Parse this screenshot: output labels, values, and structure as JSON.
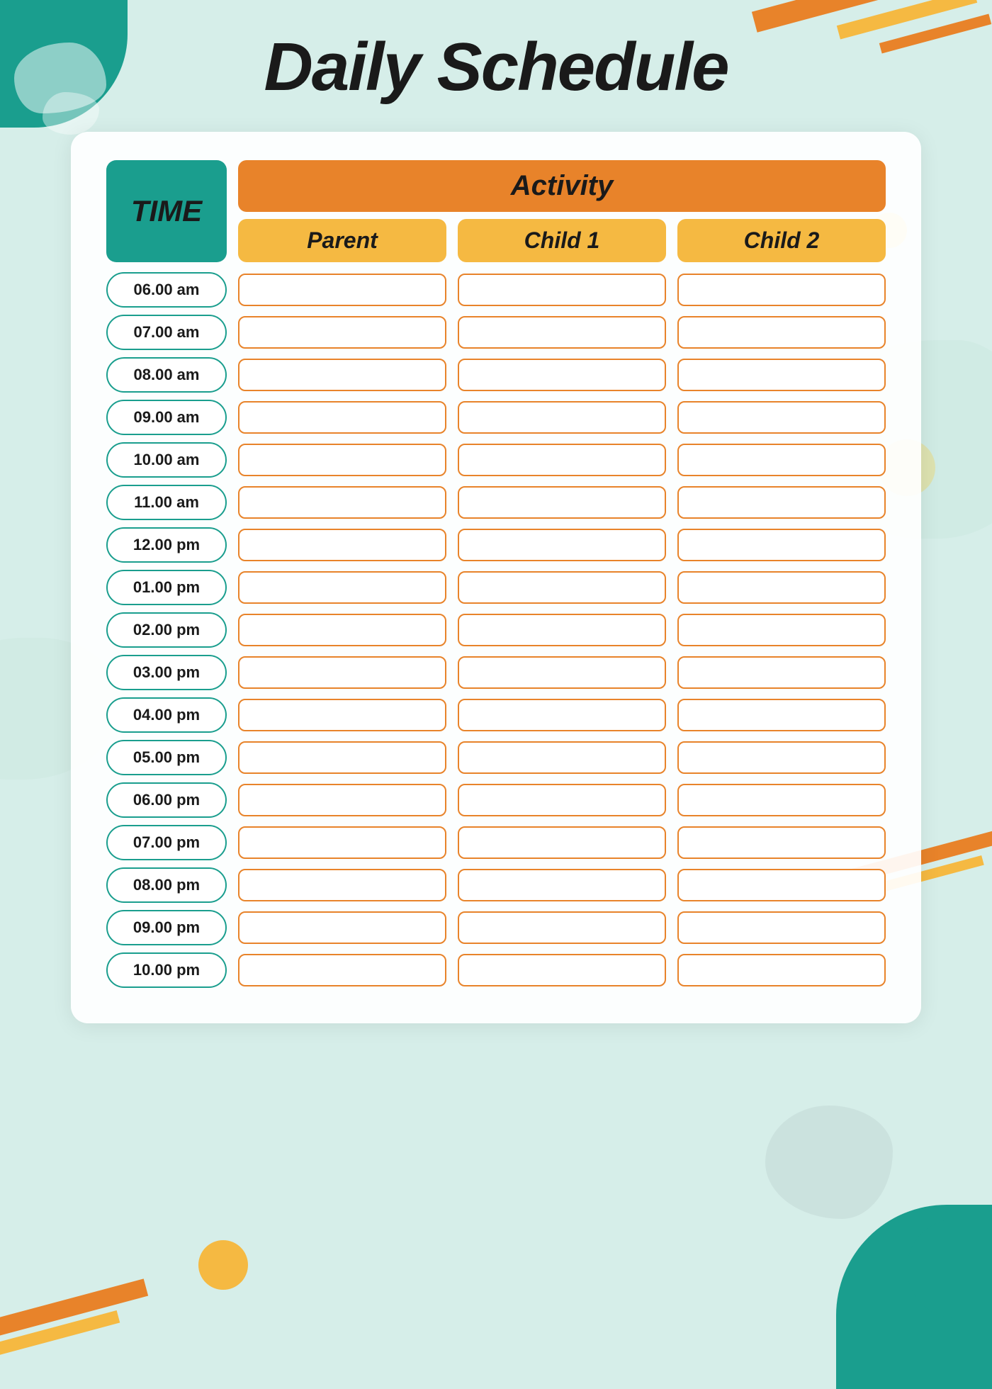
{
  "title": "Daily Schedule",
  "timeHeader": "TIME",
  "activityHeader": "Activity",
  "subHeaders": {
    "parent": "Parent",
    "child1": "Child 1",
    "child2": "Child 2"
  },
  "timeSlots": [
    "06.00 am",
    "07.00 am",
    "08.00 am",
    "09.00 am",
    "10.00 am",
    "11.00 am",
    "12.00 pm",
    "01.00 pm",
    "02.00 pm",
    "03.00 pm",
    "04.00 pm",
    "05.00 pm",
    "06.00 pm",
    "07.00 pm",
    "08.00 pm",
    "09.00 pm",
    "10.00 pm"
  ]
}
